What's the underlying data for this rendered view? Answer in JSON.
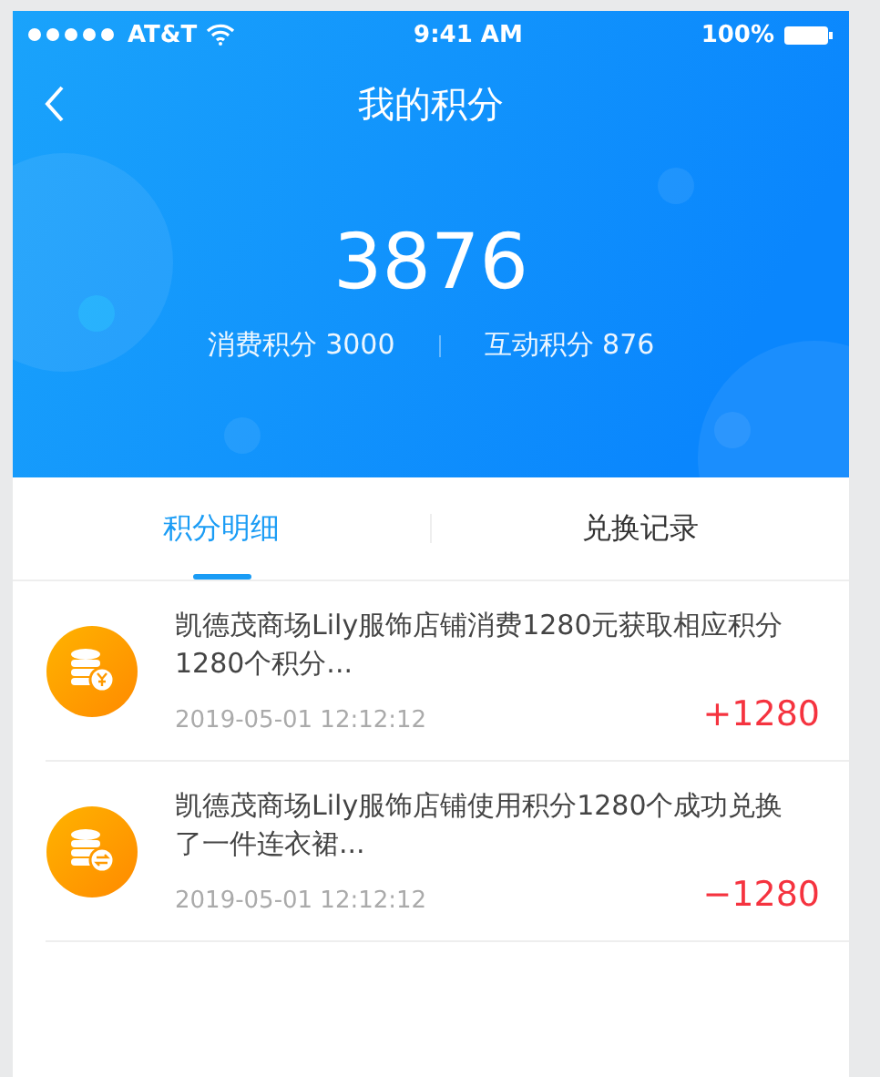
{
  "status_bar": {
    "carrier": "AT&T",
    "time": "9:41 AM",
    "battery": "100%"
  },
  "nav": {
    "title": "我的积分"
  },
  "summary": {
    "total": "3876",
    "breakdown": [
      {
        "label": "消费积分 3000"
      },
      {
        "label": "互动积分 876"
      }
    ]
  },
  "tabs": [
    {
      "label": "积分明细",
      "selected": true
    },
    {
      "label": "兑换记录",
      "selected": false
    }
  ],
  "records": [
    {
      "kind": "earn",
      "description": "凯德茂商场Lily服饰店铺消费1280元获取相应积分1280个积分...",
      "time": "2019-05-01 12:12:12",
      "amount": "+1280"
    },
    {
      "kind": "redeem",
      "description": "凯德茂商场Lily服饰店铺使用积分1280个成功兑换了一件连衣裙...",
      "time": "2019-05-01 12:12:12",
      "amount": "−1280"
    }
  ]
}
